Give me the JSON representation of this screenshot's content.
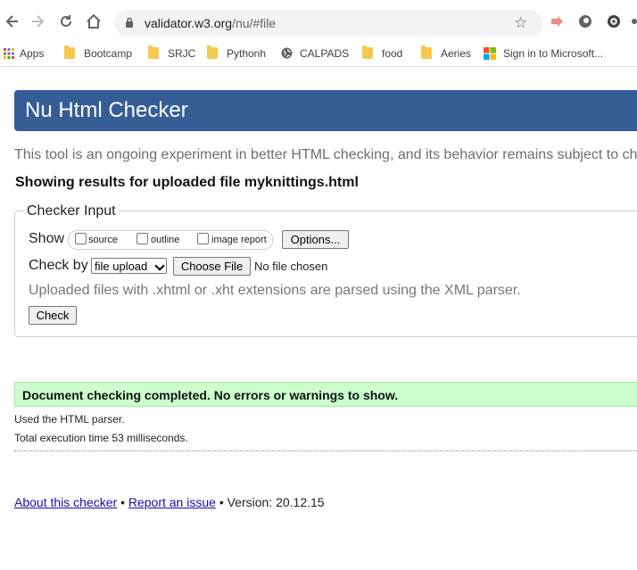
{
  "browser": {
    "url_host": "validator.w3.org",
    "url_path": "/nu/#file"
  },
  "bookmarks": [
    {
      "label": "Apps",
      "icon": "apps-grid-icon"
    },
    {
      "label": "Bootcamp",
      "icon": "folder-icon"
    },
    {
      "label": "SRJC",
      "icon": "folder-icon"
    },
    {
      "label": "Pythonh",
      "icon": "folder-icon"
    },
    {
      "label": "CALPADS",
      "icon": "globe-icon"
    },
    {
      "label": "food",
      "icon": "folder-icon"
    },
    {
      "label": "Aeries",
      "icon": "folder-icon"
    },
    {
      "label": "Sign in to Microsoft...",
      "icon": "microsoft-icon"
    }
  ],
  "page": {
    "title": "Nu Html Checker",
    "intro": "This tool is an ongoing experiment in better HTML checking, and its behavior remains subject to ch",
    "results_title": "Showing results for uploaded file myknittings.html"
  },
  "checker_input": {
    "legend": "Checker Input",
    "show_label": "Show",
    "options": [
      {
        "label": "source",
        "checked": false
      },
      {
        "label": "outline",
        "checked": false
      },
      {
        "label": "image report",
        "checked": false
      }
    ],
    "options_button": "Options...",
    "check_by_label": "Check by",
    "check_by_selected": "file upload",
    "choose_file_button": "Choose File",
    "no_file_text": "No file chosen",
    "hint": "Uploaded files with .xhtml or .xht extensions are parsed using the XML parser.",
    "check_button": "Check"
  },
  "results": {
    "success_message": "Document checking completed. No errors or warnings to show.",
    "parser_note": "Used the HTML parser.",
    "execution_time": "Total execution time 53 milliseconds."
  },
  "footer": {
    "about_link": "About this checker",
    "separator": "•",
    "report_link": "Report an issue",
    "version": "Version: 20.12.15"
  },
  "colors": {
    "header_bg": "#365d95",
    "success_bg": "#ccffcc",
    "link": "#1a0dab"
  }
}
